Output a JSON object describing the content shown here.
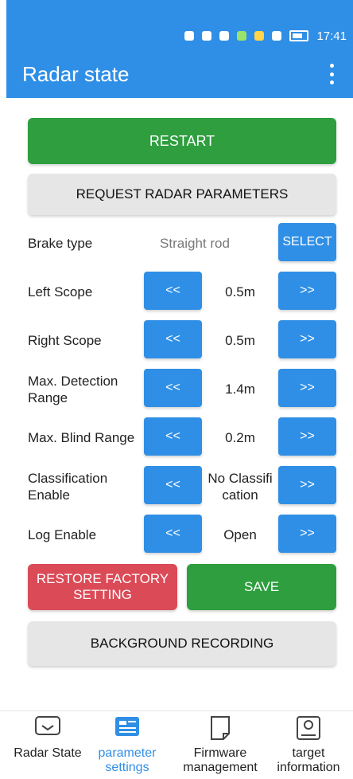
{
  "status_bar": {
    "time": "17:41"
  },
  "header": {
    "title": "Radar state"
  },
  "actions": {
    "restart": "RESTART",
    "request_params": "REQUEST RADAR PARAMETERS",
    "restore_factory": "RESTORE FACTORY SETTING",
    "save": "SAVE",
    "background_recording": "BACKGROUND RECORDING"
  },
  "params": {
    "brake_type": {
      "label": "Brake type",
      "value": "Straight rod",
      "button": "SELECT"
    },
    "left_scope": {
      "label": "Left Scope",
      "value": "0.5m"
    },
    "right_scope": {
      "label": "Right Scope",
      "value": "0.5m"
    },
    "max_detection_range": {
      "label": "Max. Detection Range",
      "value": "1.4m"
    },
    "max_blind_range": {
      "label": "Max. Blind Range",
      "value": "0.2m"
    },
    "classification_enable": {
      "label": "Classification Enable",
      "value": "No Classification"
    },
    "log_enable": {
      "label": "Log Enable",
      "value": "Open"
    },
    "decrease": "<<",
    "increase": ">>"
  },
  "nav": {
    "radar_state": "Radar State",
    "parameter_settings": "parameter settings",
    "firmware_management": "Firmware management",
    "target_information": "target information"
  },
  "colors": {
    "primary_blue": "#2f8fe6",
    "green": "#2e9e3f",
    "red": "#db4b57",
    "gray": "#e6e6e6"
  }
}
